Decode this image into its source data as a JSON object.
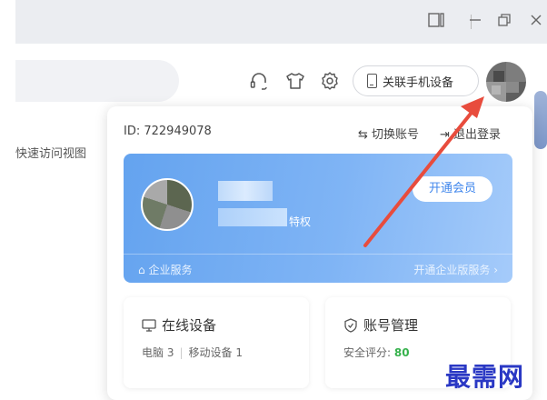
{
  "window": {
    "controls": [
      "□",
      "—",
      "⧉",
      "✕"
    ]
  },
  "toolbar": {
    "bind_phone_label": "关联手机设备",
    "icons": [
      "headset-icon",
      "shirt-icon",
      "gear-icon"
    ]
  },
  "side": {
    "quick_access_label": "快速访问视图"
  },
  "popup": {
    "user_id": "ID: 722949078",
    "switch_account": "⇆ 切换账号",
    "logout": "⇥ 退出登录",
    "card": {
      "privilege_text": "特权",
      "vip_button": "开通会员",
      "enterprise_service": "企业服务",
      "enterprise_upgrade": "开通企业版服务 ›"
    },
    "tiles": {
      "devices": {
        "title": "在线设备",
        "pc_label": "电脑 3",
        "mobile_label": "移动设备 1"
      },
      "account": {
        "title": "账号管理",
        "security_label": "安全评分: ",
        "security_score": "80"
      }
    }
  },
  "watermark": "最需网",
  "colors": {
    "accent": "#3f86ec",
    "arrow": "#e84c3d",
    "score_green": "#37b24d"
  }
}
